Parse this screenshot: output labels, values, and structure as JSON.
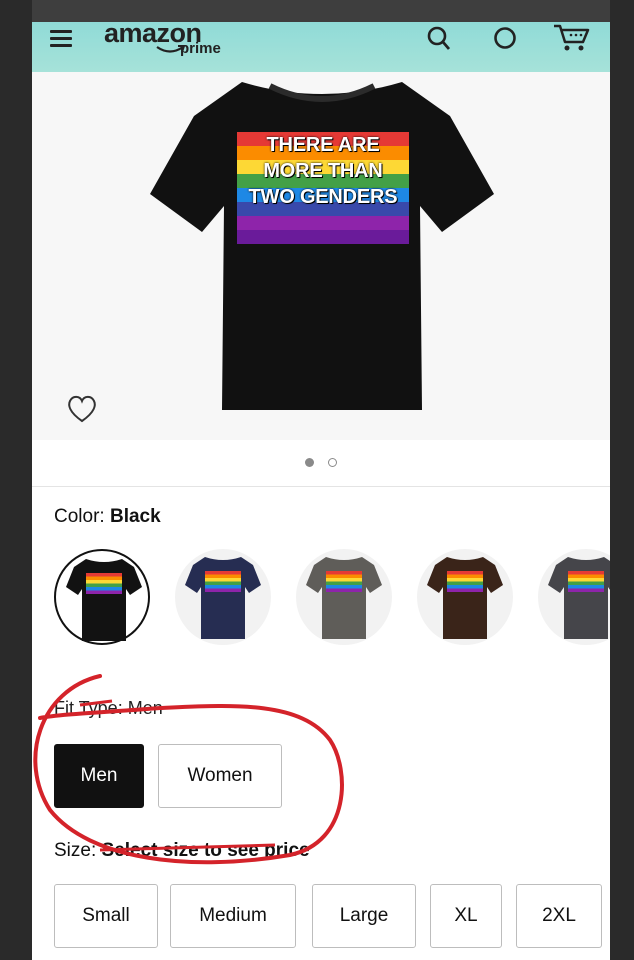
{
  "header": {
    "logo_word": "amazon",
    "logo_sub": "prime",
    "icons": [
      "menu-icon",
      "search-icon",
      "orders-icon",
      "cart-icon"
    ],
    "accent": "#86d8d6"
  },
  "product": {
    "print_lines": [
      "THERE ARE",
      "MORE THAN",
      "TWO GENDERS"
    ],
    "image_count": 2,
    "active_image": 1,
    "shirt_color": "#111111"
  },
  "color": {
    "label": "Color:",
    "value": "Black",
    "swatches": [
      {
        "name": "black",
        "hex": "#121212",
        "selected": true
      },
      {
        "name": "navy",
        "hex": "#262d52",
        "selected": false
      },
      {
        "name": "gray",
        "hex": "#5f5d59",
        "selected": false
      },
      {
        "name": "brown",
        "hex": "#3a2419",
        "selected": false
      },
      {
        "name": "charcoal",
        "hex": "#45454a",
        "selected": false
      }
    ]
  },
  "fit": {
    "label": "Fit Type: Men",
    "options": [
      {
        "label": "Men",
        "selected": true
      },
      {
        "label": "Women",
        "selected": false
      }
    ]
  },
  "size": {
    "label": "Size:",
    "value": "Select size to see price",
    "options": [
      "Small",
      "Medium",
      "Large",
      "XL",
      "2XL"
    ]
  },
  "annotation_color": "#d4232a"
}
